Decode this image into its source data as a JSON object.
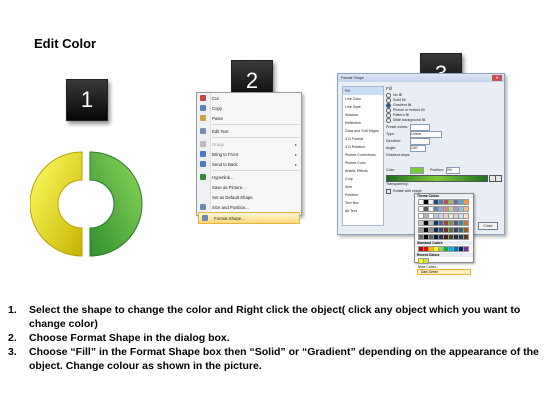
{
  "title": "Edit Color",
  "step_badges": [
    "1",
    "2",
    "3"
  ],
  "context_menu": {
    "items": [
      {
        "label": "Cut",
        "icon": "scissors-icon",
        "color": "#c44a4a",
        "submenu": false,
        "disabled": false
      },
      {
        "label": "Copy",
        "icon": "copy-icon",
        "color": "#5a7fc2",
        "submenu": false,
        "disabled": false
      },
      {
        "label": "Paste",
        "icon": "paste-icon",
        "color": "#c9a54a",
        "submenu": false,
        "disabled": false
      },
      {
        "separator": true
      },
      {
        "label": "Edit Text",
        "icon": "edit-text-icon",
        "color": "#7a8fb0",
        "submenu": false,
        "disabled": false
      },
      {
        "separator": true
      },
      {
        "label": "Group",
        "icon": "group-icon",
        "color": "#bbbbbb",
        "submenu": true,
        "disabled": true
      },
      {
        "label": "Bring to Front",
        "icon": "bring-front-icon",
        "color": "#4a78c4",
        "submenu": true,
        "disabled": false
      },
      {
        "label": "Send to Back",
        "icon": "send-back-icon",
        "color": "#4a78c4",
        "submenu": true,
        "disabled": false
      },
      {
        "separator": true
      },
      {
        "label": "Hyperlink...",
        "icon": "hyperlink-icon",
        "color": "#3a8a3a",
        "submenu": false,
        "disabled": false
      },
      {
        "label": "Save as Picture...",
        "icon": "",
        "color": "",
        "submenu": false,
        "disabled": false
      },
      {
        "label": "Set as Default Shape",
        "icon": "",
        "color": "",
        "submenu": false,
        "disabled": false
      },
      {
        "label": "Size and Position...",
        "icon": "size-position-icon",
        "color": "#6a8ab0",
        "submenu": false,
        "disabled": false
      },
      {
        "label": "Format Shape...",
        "icon": "format-shape-icon",
        "color": "#6a8ab0",
        "submenu": false,
        "disabled": false,
        "highlighted": true
      }
    ]
  },
  "format_dialog": {
    "title": "Format Shape",
    "close_glyph": "✕",
    "categories": [
      "Fill",
      "Line Color",
      "Line Style",
      "Shadow",
      "Reflection",
      "Glow and Soft Edges",
      "3-D Format",
      "3-D Rotation",
      "Picture Corrections",
      "Picture Color",
      "Artistic Effects",
      "Crop",
      "Size",
      "Position",
      "Text Box",
      "Alt Text"
    ],
    "selected_category": "Fill",
    "fill_heading": "Fill",
    "options": [
      {
        "label": "No fill",
        "on": false
      },
      {
        "label": "Solid fill",
        "on": false
      },
      {
        "label": "Gradient fill",
        "on": true
      },
      {
        "label": "Picture or texture fill",
        "on": false
      },
      {
        "label": "Pattern fill",
        "on": false
      },
      {
        "label": "Slide background fill",
        "on": false
      }
    ],
    "preset_label": "Preset colors:",
    "type_label": "Type:",
    "type_value": "Linear",
    "direction_label": "Direction:",
    "angle_label": "Angle:",
    "angle_value": "240°",
    "stops_label": "Gradient stops",
    "color_label": "Color",
    "position_label": "Position:",
    "position_value": "0%",
    "brightness_label": "Brightness:",
    "transparency_label": "Transparency:",
    "rotate_label": "Rotate with shape",
    "close_label": "Close"
  },
  "color_popup": {
    "theme_heading": "Theme Colors",
    "standard_heading": "Standard Colors",
    "recent_heading": "Recent Colors",
    "more_label": "More Colors...",
    "dark_label": "Dark Green",
    "theme_row": [
      "#ffffff",
      "#000000",
      "#eeece1",
      "#1f497d",
      "#4f81bd",
      "#c0504d",
      "#9bbb59",
      "#8064a2",
      "#4bacc6",
      "#f79646"
    ],
    "standard_row": [
      "#c00000",
      "#ff0000",
      "#ffc000",
      "#ffff00",
      "#92d050",
      "#00b050",
      "#00b0f0",
      "#0070c0",
      "#002060",
      "#7030a0"
    ],
    "recent_row": [
      "#ffff00",
      "#c8e64a"
    ]
  },
  "colors": {
    "ring_left_light": "#ffff66",
    "ring_left_dark": "#c8b400",
    "ring_right_light": "#8fd85a",
    "ring_right_dark": "#2f8f2f"
  },
  "steps": [
    {
      "n": "1.",
      "text": "Select the shape to change the color and Right click the object( click any object which you want to change color)"
    },
    {
      "n": "2.",
      "text": "Choose Format Shape in the dialog box."
    },
    {
      "n": "3.",
      "text": "Choose “Fill” in the Format Shape box then “Solid” or “Gradient” depending on the appearance of the object. Change colour as shown in the picture."
    }
  ]
}
